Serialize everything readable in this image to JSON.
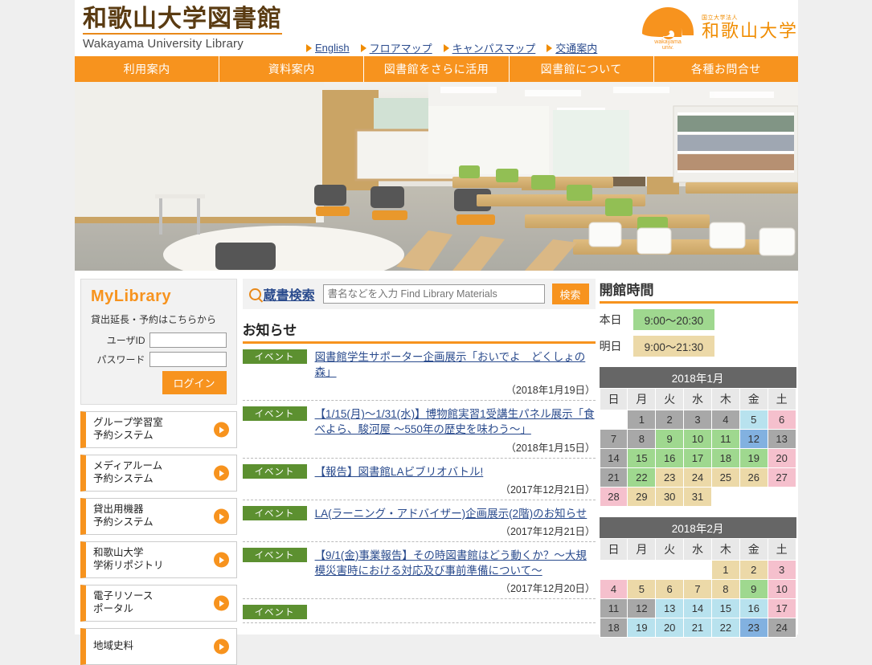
{
  "site": {
    "title_ja": "和歌山大学図書館",
    "title_en": "Wakayama University Library",
    "university_small": "国立大学法人",
    "university_name": "和歌山大学",
    "logo_caption_1": "wakayama",
    "logo_caption_2": "univ."
  },
  "toplinks": [
    {
      "label": "English"
    },
    {
      "label": "フロアマップ"
    },
    {
      "label": "キャンパスマップ"
    },
    {
      "label": "交通案内"
    }
  ],
  "gnav": [
    {
      "label": "利用案内"
    },
    {
      "label": "資料案内"
    },
    {
      "label": "図書館をさらに活用"
    },
    {
      "label": "図書館について"
    },
    {
      "label": "各種お問合せ"
    }
  ],
  "mylibrary": {
    "title": "MyLibrary",
    "subtitle": "貸出延長・予約はこちらから",
    "userid_label": "ユーザID",
    "userid_value": "",
    "password_label": "パスワード",
    "password_value": "",
    "login_label": "ログイン"
  },
  "side_buttons": [
    {
      "line1": "グループ学習室",
      "line2": "予約システム"
    },
    {
      "line1": "メディアルーム",
      "line2": "予約システム"
    },
    {
      "line1": "貸出用機器",
      "line2": "予約システム"
    },
    {
      "line1": "和歌山大学",
      "line2": "学術リポジトリ"
    },
    {
      "line1": "電子リソース",
      "line2": "ポータル"
    },
    {
      "line1": "地域史料",
      "line2": ""
    }
  ],
  "search": {
    "label": "蔵書検索",
    "placeholder": "書名などを入力 Find Library Materials",
    "value": "",
    "button_label": "検索"
  },
  "news": {
    "heading": "お知らせ",
    "items": [
      {
        "badge": "イベント",
        "title": "図書館学生サポーター企画展示「おいでよ　どくしょの森」",
        "date": "（2018年1月19日）"
      },
      {
        "badge": "イベント",
        "title": "【1/15(月)〜1/31(水)】博物館実習1受講生パネル展示「食べよら、駿河屋 〜550年の歴史を味わう〜」",
        "date": "（2018年1月15日）"
      },
      {
        "badge": "イベント",
        "title": "【報告】図書館LAビブリオバトル!",
        "date": "（2017年12月21日）"
      },
      {
        "badge": "イベント",
        "title": "LA(ラーニング・アドバイザー)企画展示(2階)のお知らせ",
        "date": "（2017年12月21日）"
      },
      {
        "badge": "イベント",
        "title": "【9/1(金)事業報告】その時図書館はどう動くか？〜大規模災害時における対応及び事前準備について〜",
        "date": "（2017年12月20日）"
      },
      {
        "badge": "イベント",
        "title": "",
        "date": ""
      }
    ]
  },
  "hours": {
    "heading": "開館時間",
    "today_label": "本日",
    "today_value": "9:00〜20:30",
    "today_color": "#9fd88f",
    "tomorrow_label": "明日",
    "tomorrow_value": "9:00〜21:30",
    "tomorrow_color": "#ecd9a8"
  },
  "calendars": [
    {
      "caption": "2018年1月",
      "weekdays": [
        "日",
        "月",
        "火",
        "水",
        "木",
        "金",
        "土"
      ],
      "weeks": [
        [
          {
            "d": "",
            "s": "none"
          },
          {
            "d": "1",
            "s": "gray"
          },
          {
            "d": "2",
            "s": "gray"
          },
          {
            "d": "3",
            "s": "gray"
          },
          {
            "d": "4",
            "s": "gray"
          },
          {
            "d": "5",
            "s": "cyan"
          },
          {
            "d": "6",
            "s": "pink"
          }
        ],
        [
          {
            "d": "7",
            "s": "gray"
          },
          {
            "d": "8",
            "s": "gray"
          },
          {
            "d": "9",
            "s": "green"
          },
          {
            "d": "10",
            "s": "green"
          },
          {
            "d": "11",
            "s": "green"
          },
          {
            "d": "12",
            "s": "blue"
          },
          {
            "d": "13",
            "s": "gray"
          }
        ],
        [
          {
            "d": "14",
            "s": "gray"
          },
          {
            "d": "15",
            "s": "green"
          },
          {
            "d": "16",
            "s": "green"
          },
          {
            "d": "17",
            "s": "green"
          },
          {
            "d": "18",
            "s": "green"
          },
          {
            "d": "19",
            "s": "green"
          },
          {
            "d": "20",
            "s": "pink"
          }
        ],
        [
          {
            "d": "21",
            "s": "gray"
          },
          {
            "d": "22",
            "s": "green"
          },
          {
            "d": "23",
            "s": "beige"
          },
          {
            "d": "24",
            "s": "beige"
          },
          {
            "d": "25",
            "s": "beige"
          },
          {
            "d": "26",
            "s": "beige"
          },
          {
            "d": "27",
            "s": "pink"
          }
        ],
        [
          {
            "d": "28",
            "s": "pink"
          },
          {
            "d": "29",
            "s": "beige"
          },
          {
            "d": "30",
            "s": "beige"
          },
          {
            "d": "31",
            "s": "beige"
          },
          {
            "d": "",
            "s": "none"
          },
          {
            "d": "",
            "s": "none"
          },
          {
            "d": "",
            "s": "none"
          }
        ]
      ]
    },
    {
      "caption": "2018年2月",
      "weekdays": [
        "日",
        "月",
        "火",
        "水",
        "木",
        "金",
        "土"
      ],
      "weeks": [
        [
          {
            "d": "",
            "s": "none"
          },
          {
            "d": "",
            "s": "none"
          },
          {
            "d": "",
            "s": "none"
          },
          {
            "d": "",
            "s": "none"
          },
          {
            "d": "1",
            "s": "beige"
          },
          {
            "d": "2",
            "s": "beige"
          },
          {
            "d": "3",
            "s": "pink"
          }
        ],
        [
          {
            "d": "4",
            "s": "pink"
          },
          {
            "d": "5",
            "s": "beige"
          },
          {
            "d": "6",
            "s": "beige"
          },
          {
            "d": "7",
            "s": "beige"
          },
          {
            "d": "8",
            "s": "beige"
          },
          {
            "d": "9",
            "s": "green"
          },
          {
            "d": "10",
            "s": "pink"
          }
        ],
        [
          {
            "d": "11",
            "s": "gray"
          },
          {
            "d": "12",
            "s": "gray"
          },
          {
            "d": "13",
            "s": "cyan"
          },
          {
            "d": "14",
            "s": "cyan"
          },
          {
            "d": "15",
            "s": "cyan"
          },
          {
            "d": "16",
            "s": "cyan"
          },
          {
            "d": "17",
            "s": "pink"
          }
        ],
        [
          {
            "d": "18",
            "s": "gray"
          },
          {
            "d": "19",
            "s": "cyan"
          },
          {
            "d": "20",
            "s": "cyan"
          },
          {
            "d": "21",
            "s": "cyan"
          },
          {
            "d": "22",
            "s": "cyan"
          },
          {
            "d": "23",
            "s": "blue"
          },
          {
            "d": "24",
            "s": "gray"
          }
        ]
      ]
    }
  ],
  "colors": {
    "brand_orange": "#f7931e",
    "link_blue": "#2a4b8d",
    "badge_green": "#5c9030",
    "heading_brown": "#5a3b12"
  }
}
